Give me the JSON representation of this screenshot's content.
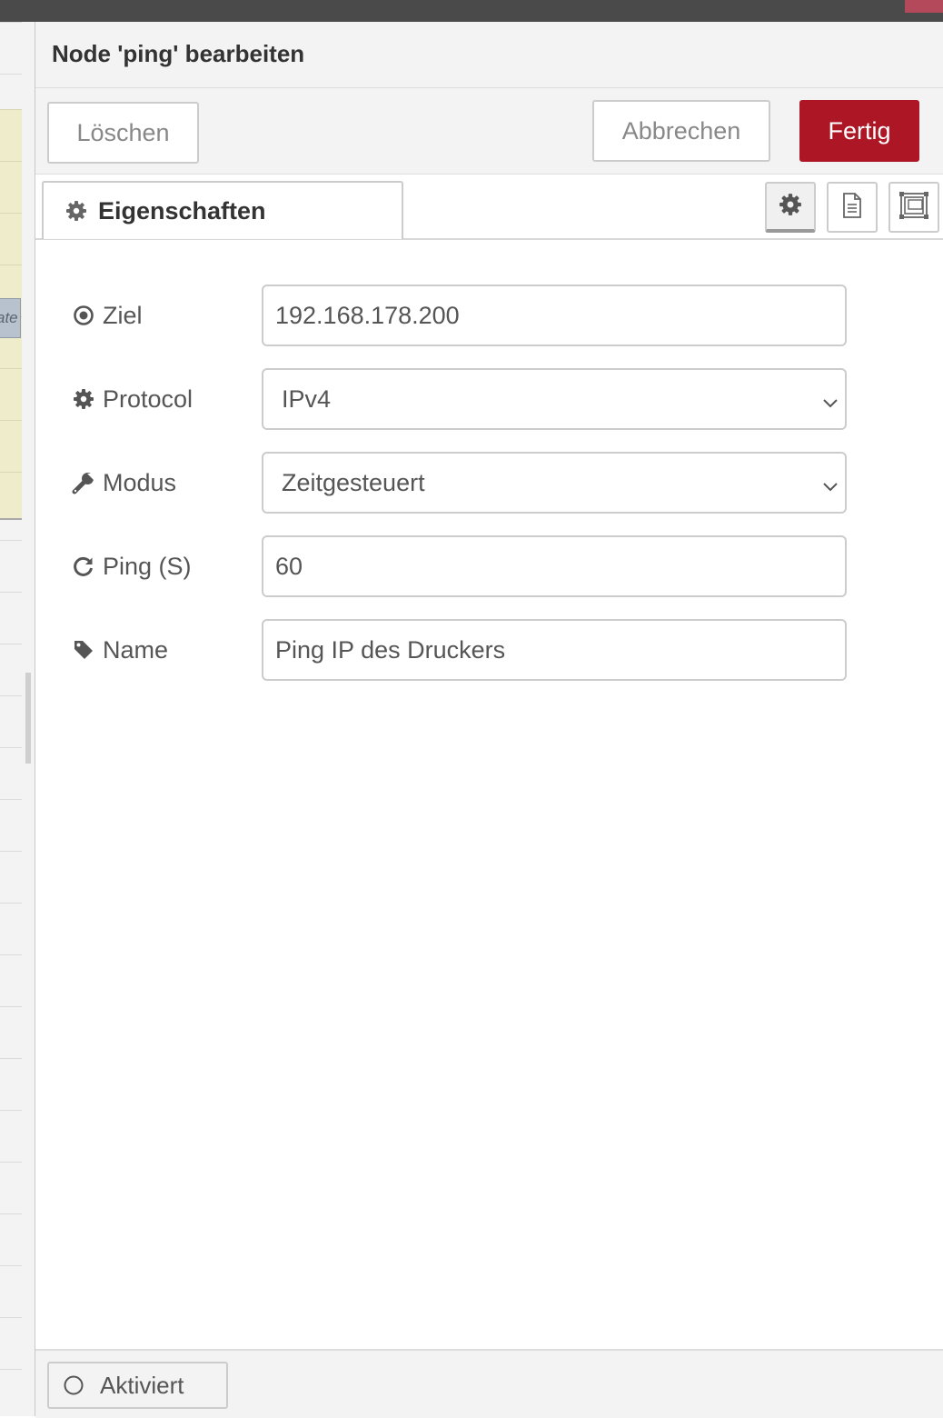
{
  "window": {
    "title": "Node 'ping' bearbeiten"
  },
  "workspace": {
    "node_fragment_text": "ate"
  },
  "toolbar": {
    "delete_label": "Löschen",
    "cancel_label": "Abbrechen",
    "done_label": "Fertig",
    "done_color": "#ad1625"
  },
  "tabs": [
    {
      "label": "Eigenschaften",
      "icon": "gear-icon"
    }
  ],
  "tab_buttons": [
    {
      "icon": "gear-icon",
      "active": true
    },
    {
      "icon": "document-icon",
      "active": false
    },
    {
      "icon": "appearance-frame-icon",
      "active": false
    }
  ],
  "form": {
    "target": {
      "label": "Ziel",
      "icon": "dot-circle-icon",
      "value": "192.168.178.200"
    },
    "protocol": {
      "label": "Protocol",
      "icon": "gear-icon",
      "value": "IPv4"
    },
    "mode": {
      "label": "Modus",
      "icon": "wrench-icon",
      "value": "Zeitgesteuert"
    },
    "interval": {
      "label": "Ping (S)",
      "icon": "refresh-icon",
      "value": "60"
    },
    "name": {
      "label": "Name",
      "icon": "tag-icon",
      "value": "Ping IP des Druckers"
    }
  },
  "footer": {
    "enabled_label": "Aktiviert",
    "icon": "circle-outline-icon"
  }
}
